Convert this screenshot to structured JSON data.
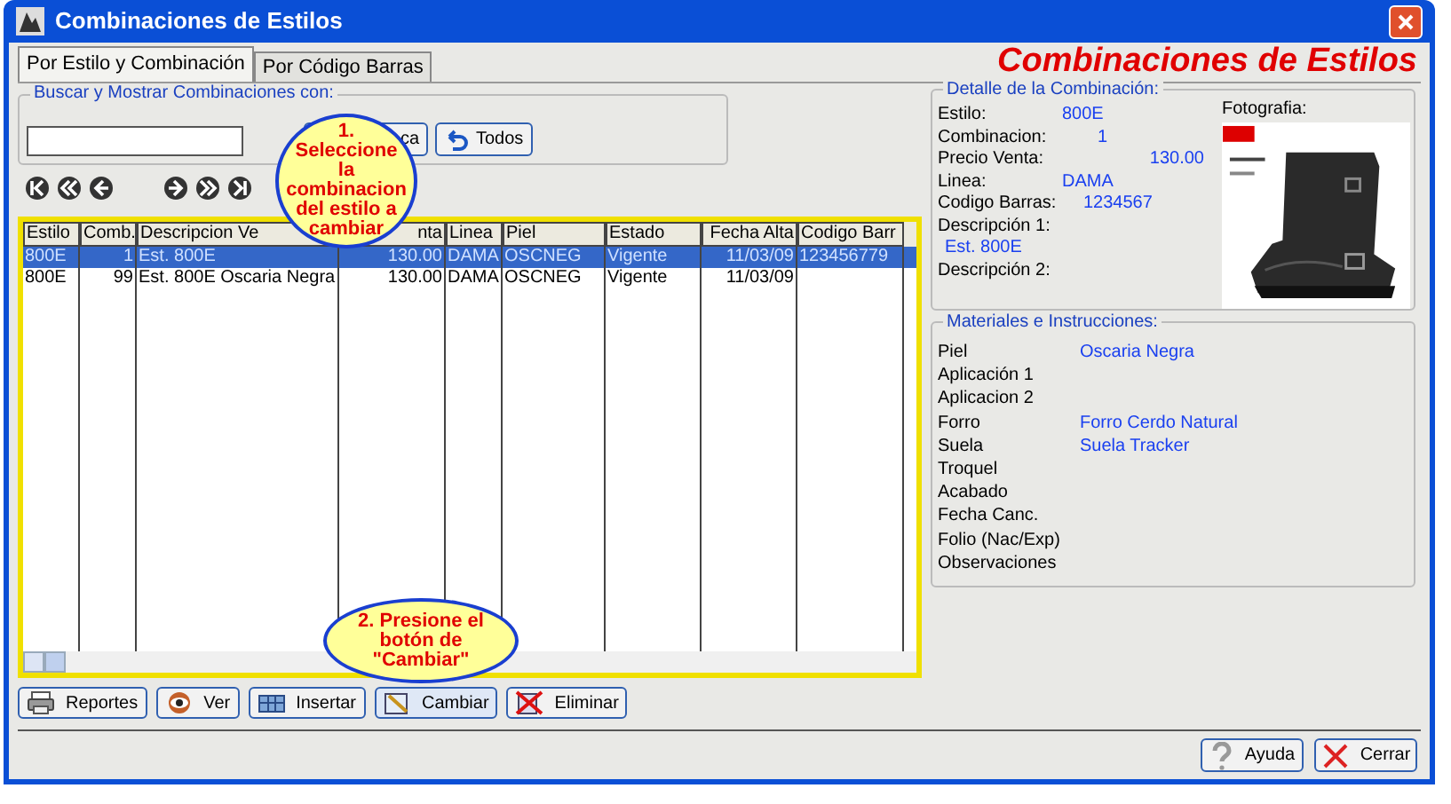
{
  "window": {
    "title": "Combinaciones de Estilos",
    "heading": "Combinaciones de Estilos"
  },
  "tabs": [
    {
      "label": "Por Estilo y Combinación",
      "selected": true
    },
    {
      "label": "Por Código Barras",
      "selected": false
    }
  ],
  "search": {
    "label": "Buscar y Mostrar Combinaciones con:",
    "buttons": [
      "ca",
      "Todos"
    ]
  },
  "table": {
    "columns": [
      "Estilo",
      "Comb.",
      "Descripcion Ve",
      "nta",
      "Linea",
      "Piel",
      "Estado",
      "Fecha Alta",
      "Codigo Barr"
    ],
    "rows": [
      {
        "selected": true,
        "cells": [
          "800E",
          "1",
          "Est. 800E",
          "130.00",
          "DAMA",
          "OSCNEG",
          "Vigente",
          "11/03/09",
          "123456779"
        ]
      },
      {
        "selected": false,
        "cells": [
          "800E",
          "99",
          "Est. 800E Oscaria Negra",
          "130.00",
          "DAMA",
          "OSCNEG",
          "Vigente",
          "11/03/09",
          ""
        ]
      }
    ]
  },
  "callouts": [
    "1. Seleccione la combinacion del estilo a cambiar",
    "2. Presione el botón de \"Cambiar\""
  ],
  "actions": [
    {
      "label": "Reportes",
      "kind": "printer",
      "selected": false
    },
    {
      "label": "Ver",
      "kind": "eye",
      "selected": false
    },
    {
      "label": "Insertar",
      "kind": "insert",
      "selected": false
    },
    {
      "label": "Cambiar",
      "kind": "edit",
      "selected": true
    },
    {
      "label": "Eliminar",
      "kind": "delete",
      "selected": false
    }
  ],
  "detail": {
    "title": "Detalle de la Combinación:",
    "fields": [
      {
        "label": "Estilo:",
        "value": "800E"
      },
      {
        "label": "Combinacion:",
        "value": "1"
      },
      {
        "label": "Precio Venta:",
        "value": "130.00"
      },
      {
        "label": "Linea:",
        "value": "DAMA"
      },
      {
        "label": "Codigo Barras:",
        "value": "1234567"
      },
      {
        "label": "Descripción 1:",
        "value": "Est. 800E"
      },
      {
        "label": "Descripción 2:"
      }
    ],
    "photo_label": "Fotografia:"
  },
  "materials": {
    "title": "Materiales e Instrucciones:",
    "fields": [
      {
        "label": "Piel",
        "value": "Oscaria Negra"
      },
      {
        "label": "Aplicación 1"
      },
      {
        "label": "Aplicacion 2"
      },
      {
        "label": "Forro",
        "value": "Forro Cerdo Natural"
      },
      {
        "label": "Suela",
        "value": "Suela Tracker"
      },
      {
        "label": "Troquel"
      },
      {
        "label": "Acabado"
      },
      {
        "label": "Fecha Canc."
      },
      {
        "label": "Folio (Nac/Exp)"
      },
      {
        "label": "Observaciones"
      }
    ]
  },
  "footer_buttons": [
    {
      "label": "Ayuda",
      "kind": "help"
    },
    {
      "label": "Cerrar",
      "kind": "close"
    }
  ]
}
